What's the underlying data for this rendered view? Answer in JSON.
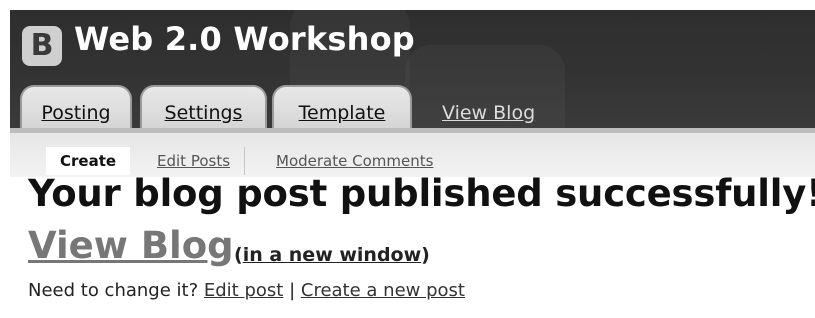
{
  "app": {
    "title": "Web 2.0 Workshop",
    "logo_letter": "B",
    "logo_icon": "blogger-icon"
  },
  "tabs": [
    {
      "label": "Posting",
      "active": true
    },
    {
      "label": "Settings"
    },
    {
      "label": "Template"
    },
    {
      "label": "View Blog"
    }
  ],
  "subtabs": [
    {
      "label": "Create",
      "active": true
    },
    {
      "label": "Edit Posts"
    },
    {
      "label": "Moderate Comments"
    }
  ],
  "main": {
    "headline": "Your blog post published successfully!",
    "view_blog_link": "View Blog",
    "new_window_open": "(",
    "new_window_link": "in a new window",
    "new_window_close": ")",
    "change_prompt": "Need to change it?",
    "edit_post_link": "Edit post",
    "separator": "|",
    "create_post_link": "Create a new post"
  },
  "colors": {
    "header_bg": "#333333",
    "tab_bg": "#d9d9d9",
    "subbar_bg": "#ececec",
    "link_gray": "#777777"
  }
}
